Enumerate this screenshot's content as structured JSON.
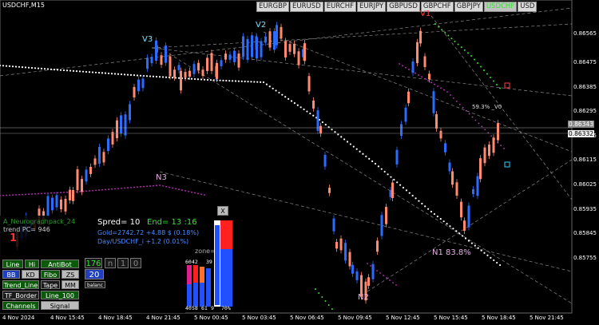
{
  "window": {
    "title": "USDCHF,M15"
  },
  "symbols": [
    "EURGBP",
    "EURUSD",
    "EURCHF",
    "EURJPY",
    "GBPUSD",
    "GBPCHF",
    "GBPJPY",
    "USDCHF",
    "USD"
  ],
  "active_symbol": "USDCHF",
  "price_axis": [
    "0.86475",
    "0.86385",
    "0.86295",
    "0.86205",
    "0.86115",
    "0.86025",
    "0.85935",
    "0.85845",
    "0.85755"
  ],
  "price_axis_top": "0.86565",
  "price_tags": {
    "bid": "0.86343",
    "ask": "0.86332"
  },
  "time_axis": [
    "4 Nov 2024",
    "4 Nov 15:45",
    "4 Nov 18:45",
    "4 Nov 21:45",
    "5 Nov 00:45",
    "5 Nov 03:45",
    "5 Nov 06:45",
    "5 Nov 09:45",
    "5 Nov 12:45",
    "5 Nov 15:45",
    "5 Nov 18:45",
    "5 Nov 21:45"
  ],
  "wave_labels": {
    "v1": "V1",
    "v2": "V2",
    "v3": "V3",
    "n1": "N1 83.8%",
    "n2": "N2",
    "n3": "N3",
    "v0": "59.3% _V0"
  },
  "panel": {
    "indicator_name": "A_Neurographpack_24",
    "trend_pc": "trend PC= 946",
    "trend_digit": "1",
    "spread": "Spred= 10",
    "end": "End= 13 :16",
    "gold": "Gold=2742.72 +4.88 $ (0.18%)",
    "day": "Day/USDCHF_i  +1.2 (0.01%)",
    "zone": "zone= 4",
    "close_x": "X",
    "count_176": "176",
    "count_n": "n",
    "count_1": "1",
    "count_0": "0",
    "count_20": "20",
    "balance": "balanc",
    "pct_top": "30%",
    "pct_bottom": "70%",
    "bar_labels_top": [
      "60",
      "42",
      "39"
    ],
    "bar_labels_bottom": [
      "40",
      "58",
      "61",
      "9"
    ],
    "buttons": {
      "line": "Line",
      "hi": "Hi",
      "antibot": "AntiBot",
      "bb": "BB",
      "kd": "KD",
      "fibo": "Fibo",
      "zs": "ZS",
      "trend_line": "Trend_Line",
      "tape": "Tape",
      "mm": "MM",
      "tf_border": "TF_Border",
      "line100": "Line_100",
      "channels": "Channels",
      "signal": "Signal"
    }
  },
  "colors": {
    "bull": "#2a6cff",
    "bear": "#ff8a6e",
    "accent_green": "#2ee82e",
    "dots": "#ffffff",
    "magenta": "#d030d0"
  }
}
